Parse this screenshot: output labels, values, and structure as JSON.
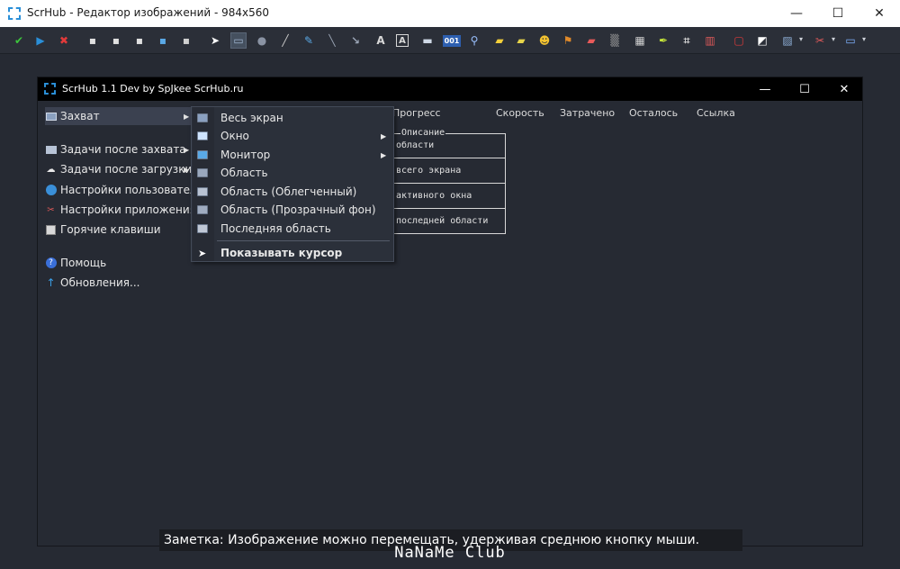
{
  "window": {
    "title": "ScrHub - Редактор изображений - 984x560",
    "minimize": "—",
    "maximize": "☐",
    "close": "✕"
  },
  "toolbar": {
    "tools": [
      {
        "name": "apply-check-icon",
        "glyph": "✔",
        "color": "#3cc43c"
      },
      {
        "name": "play-arrow-icon",
        "glyph": "▶",
        "color": "#2a8fd8"
      },
      {
        "name": "cancel-x-icon",
        "glyph": "✖",
        "color": "#e23a3a"
      },
      {
        "name": "save-icon",
        "glyph": "▪",
        "color": "#e0e0e0"
      },
      {
        "name": "save-all-icon",
        "glyph": "▪",
        "color": "#e0e0e0"
      },
      {
        "name": "clipboard-icon",
        "glyph": "▪",
        "color": "#e0e0e0"
      },
      {
        "name": "upload-icon",
        "glyph": "▪",
        "color": "#5aa9e6"
      },
      {
        "name": "print-icon",
        "glyph": "▪",
        "color": "#d0d0d0"
      },
      {
        "name": "pointer-tool-icon",
        "glyph": "➤",
        "color": "#ffffff"
      },
      {
        "name": "rectangle-tool-icon",
        "glyph": "▭",
        "color": "#9fb4cf"
      },
      {
        "name": "ellipse-tool-icon",
        "glyph": "●",
        "color": "#8a93a3"
      },
      {
        "name": "line-tool-icon",
        "glyph": "╱",
        "color": "#c8c8c8"
      },
      {
        "name": "pencil-tool-icon",
        "glyph": "✎",
        "color": "#5aa9e6"
      },
      {
        "name": "dashed-line-tool-icon",
        "glyph": "╲",
        "color": "#9aa4b5"
      },
      {
        "name": "arrow-tool-icon",
        "glyph": "↘",
        "color": "#9aa4b5"
      },
      {
        "name": "text-tool-icon",
        "glyph": "A",
        "color": "#d8d8d8"
      },
      {
        "name": "text-box-tool-icon",
        "glyph": "A",
        "color": "#d8d8d8"
      },
      {
        "name": "speech-bubble-icon",
        "glyph": "▬",
        "color": "#cfd8e6"
      },
      {
        "name": "counter-tool-icon",
        "glyph": "001",
        "color": "#7fb2ff"
      },
      {
        "name": "magnifier-icon",
        "glyph": "⚲",
        "color": "#9ac1ff"
      },
      {
        "name": "sticky-note-icon",
        "glyph": "▰",
        "color": "#f3cf3a"
      },
      {
        "name": "highlight-note-icon",
        "glyph": "▰",
        "color": "#e6d44a"
      },
      {
        "name": "emoji-icon",
        "glyph": "☻",
        "color": "#f2c230"
      },
      {
        "name": "stamp-icon",
        "glyph": "⚑",
        "color": "#e08a2a"
      },
      {
        "name": "eraser-icon",
        "glyph": "▰",
        "color": "#e85a5a"
      },
      {
        "name": "blur-icon",
        "glyph": "▒",
        "color": "#9a9a9a"
      },
      {
        "name": "grid-icon",
        "glyph": "▦",
        "color": "#d0d0d0"
      },
      {
        "name": "marker-icon",
        "glyph": "✒",
        "color": "#c8e83a"
      },
      {
        "name": "crop-icon",
        "glyph": "⌗",
        "color": "#d0d0d0"
      },
      {
        "name": "flip-icon",
        "glyph": "▥",
        "color": "#e05a5a"
      },
      {
        "name": "border-color-icon",
        "glyph": "▢",
        "color": "#e03a3a"
      },
      {
        "name": "fill-color-icon",
        "glyph": "◩",
        "color": "#ffffff"
      },
      {
        "name": "effects-icon",
        "glyph": "▨",
        "color": "#8fb0d8"
      },
      {
        "name": "tools-icon",
        "glyph": "✂",
        "color": "#e05a5a"
      },
      {
        "name": "export-icon",
        "glyph": "▭",
        "color": "#7fb2ff"
      }
    ]
  },
  "app": {
    "title": "ScrHub 1.1 Dev by SpJkee ScrHub.ru",
    "minimize": "—",
    "maximize": "☐",
    "close": "✕"
  },
  "menu": {
    "capture": "Захват",
    "after_capture": "Задачи после захвата",
    "after_upload": "Задачи после загрузки",
    "user_settings": "Настройки пользователя",
    "app_settings": "Настройки приложения",
    "hotkeys": "Горячие клавиши",
    "help": "Помощь",
    "updates": "Обновления..."
  },
  "columns": {
    "progress": "Прогресс",
    "speed": "Скорость",
    "spent": "Затрачено",
    "remaining": "Осталось",
    "link": "Ссылка"
  },
  "description": {
    "legend": "Описание",
    "rows": [
      "области",
      "всего экрана",
      "активного окна",
      "последней области"
    ]
  },
  "submenu": {
    "items": [
      {
        "label": "Весь экран",
        "color": "#8aa0c0"
      },
      {
        "label": "Окно",
        "color": "#cfe4ff"
      },
      {
        "label": "Монитор",
        "color": "#5aa9e6"
      },
      {
        "label": "Область",
        "color": "#9aa8bd"
      },
      {
        "label": "Область (Облегченный)",
        "color": "#b8c2d2"
      },
      {
        "label": "Область (Прозрачный фон)",
        "color": "#a0acc0"
      },
      {
        "label": "Последняя область",
        "color": "#c0c8d6"
      }
    ],
    "show_cursor": "Показывать курсор"
  },
  "note": "Заметка: Изображение можно перемещать, удерживая среднюю кнопку мыши.",
  "watermark": "NaNaMe Club"
}
